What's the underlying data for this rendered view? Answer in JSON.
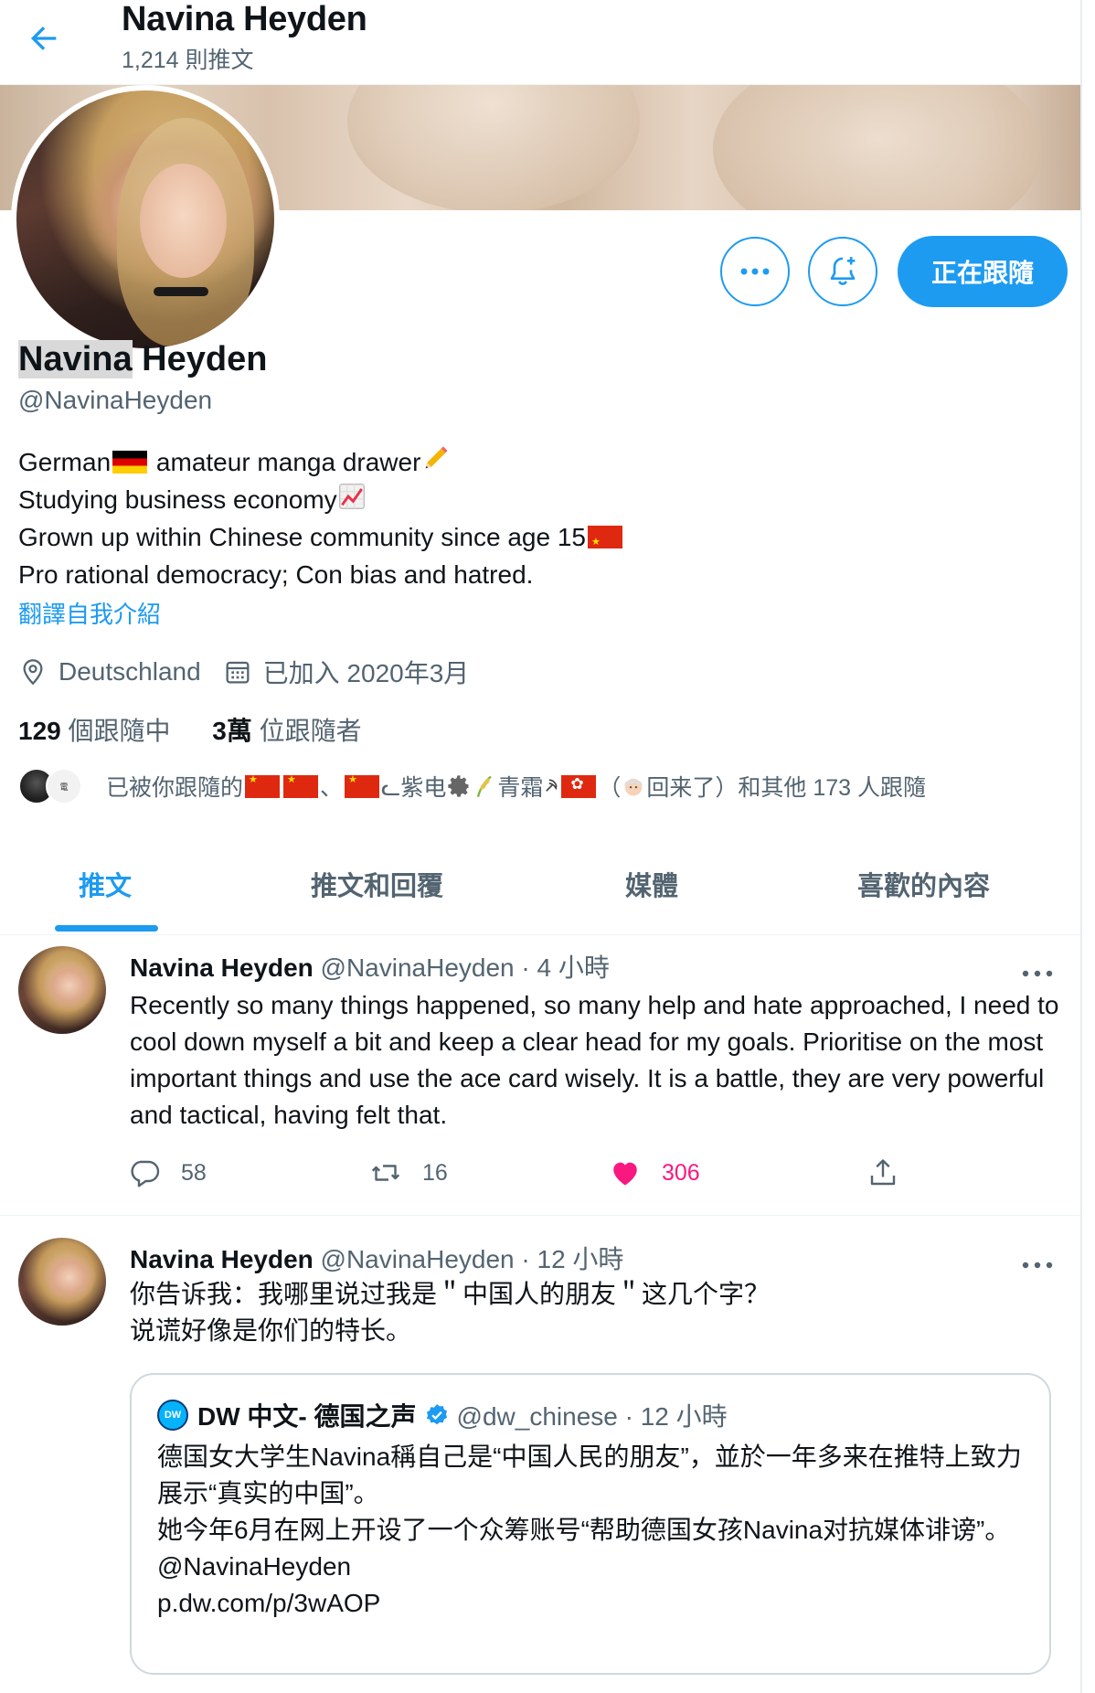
{
  "header": {
    "name": "Navina Heyden",
    "tweet_count": "1,214 則推文"
  },
  "profile": {
    "name_part1": "Navina",
    "name_part2": " Heyden",
    "handle": "@NavinaHeyden",
    "follow_button": "正在跟隨",
    "bio": [
      "German",
      " amateur manga drawer",
      "Studying business economy",
      "Grown up within Chinese community since age 15",
      "Pro rational democracy; Con bias and hatred."
    ],
    "translate_bio": "翻譯自我介紹",
    "location": "Deutschland",
    "joined": "已加入 2020年3月",
    "following_count": "129",
    "following_label": " 個跟隨中",
    "followers_count": "3萬",
    "followers_label": " 位跟隨者",
    "followed_by": {
      "prefix": "已被你跟隨的 ",
      "sep": "、",
      "name2": "ᓚ紫电",
      "name3": "青霜",
      "paren_open": "（",
      "name4": "回来了）",
      "suffix": " 和其他 173 人跟隨"
    },
    "mini_avatar_text": "電"
  },
  "tabs": [
    "推文",
    "推文和回覆",
    "媒體",
    "喜歡的內容"
  ],
  "tweets": [
    {
      "name": "Navina Heyden",
      "handle": " @NavinaHeyden · 4 小時",
      "text": "Recently so many things happened, so many help and hate approached, I need to cool down myself a bit and keep a clear head for my goals. Prioritise on the most important things and use the ace card wisely. It is a battle, they are very powerful and tactical, having felt that.",
      "replies": "58",
      "retweets": "16",
      "likes": "306"
    },
    {
      "name": "Navina Heyden",
      "handle": " @NavinaHeyden · 12 小時",
      "text_line1": "你告诉我：我哪里说过我是＂中国人的朋友＂这几个字？",
      "text_line2": "说谎好像是你们的特长。",
      "quote": {
        "logo": "DW",
        "name": "DW 中文- 德国之声",
        "handle": "@dw_chinese · 12 小時",
        "line1": "德国女大学生Navina稱自己是“中国人民的朋友”，並於一年多来在推特上致力展示“真实的中国”。",
        "line2": "她今年6月在网上开设了一个众筹账号“帮助德国女孩Navina对抗媒体诽谤”。",
        "line3": "@NavinaHeyden",
        "line4": "p.dw.com/p/3wAOP"
      }
    }
  ],
  "colors": {
    "accent": "#1d9bf0",
    "like": "#f91880",
    "secondary_text": "#536471"
  }
}
